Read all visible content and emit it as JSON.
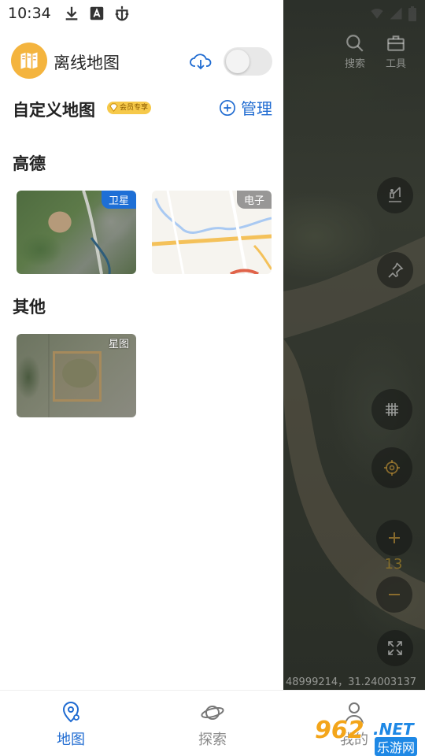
{
  "status_bar": {
    "time": "10:34",
    "icons": [
      "download-icon",
      "font-a-icon",
      "bug-icon",
      "wifi-icon",
      "signal-icon",
      "battery-icon"
    ]
  },
  "map": {
    "tools": [
      {
        "label": "搜索",
        "icon": "search-icon"
      },
      {
        "label": "工具",
        "icon": "toolbox-icon"
      }
    ],
    "buttons": [
      "fishing-icon",
      "pin-icon",
      "grid-icon",
      "locate-icon",
      "zoom-in-icon",
      "zoom-out-icon",
      "fullscreen-icon"
    ],
    "zoom_level": "13",
    "coords": "48999214，31.24003137"
  },
  "drawer": {
    "title": "离线地图",
    "toggle_on": false,
    "custom_map": {
      "title": "自定义地图",
      "vip_label": "会员专享",
      "manage_label": "管理"
    },
    "sections": [
      {
        "title": "高德",
        "tiles": [
          {
            "badge": "卫星",
            "type": "satellite"
          },
          {
            "badge": "电子",
            "type": "electronic"
          }
        ]
      },
      {
        "title": "其他",
        "tiles": [
          {
            "badge": "星图",
            "type": "star"
          }
        ]
      }
    ]
  },
  "bottom_nav": {
    "items": [
      {
        "label": "地图",
        "icon": "map-pin-icon",
        "active": true
      },
      {
        "label": "探索",
        "icon": "planet-icon",
        "active": false
      },
      {
        "label": "我的",
        "icon": "person-icon",
        "active": false
      }
    ]
  },
  "watermark": {
    "number": "962",
    "net": ".NET",
    "cn": "乐游网"
  },
  "colors": {
    "accent": "#1f6bd1",
    "logo_bg": "#f4b43e",
    "vip_bg": "#f6c94a",
    "badge_blue": "#1e6fd6"
  }
}
